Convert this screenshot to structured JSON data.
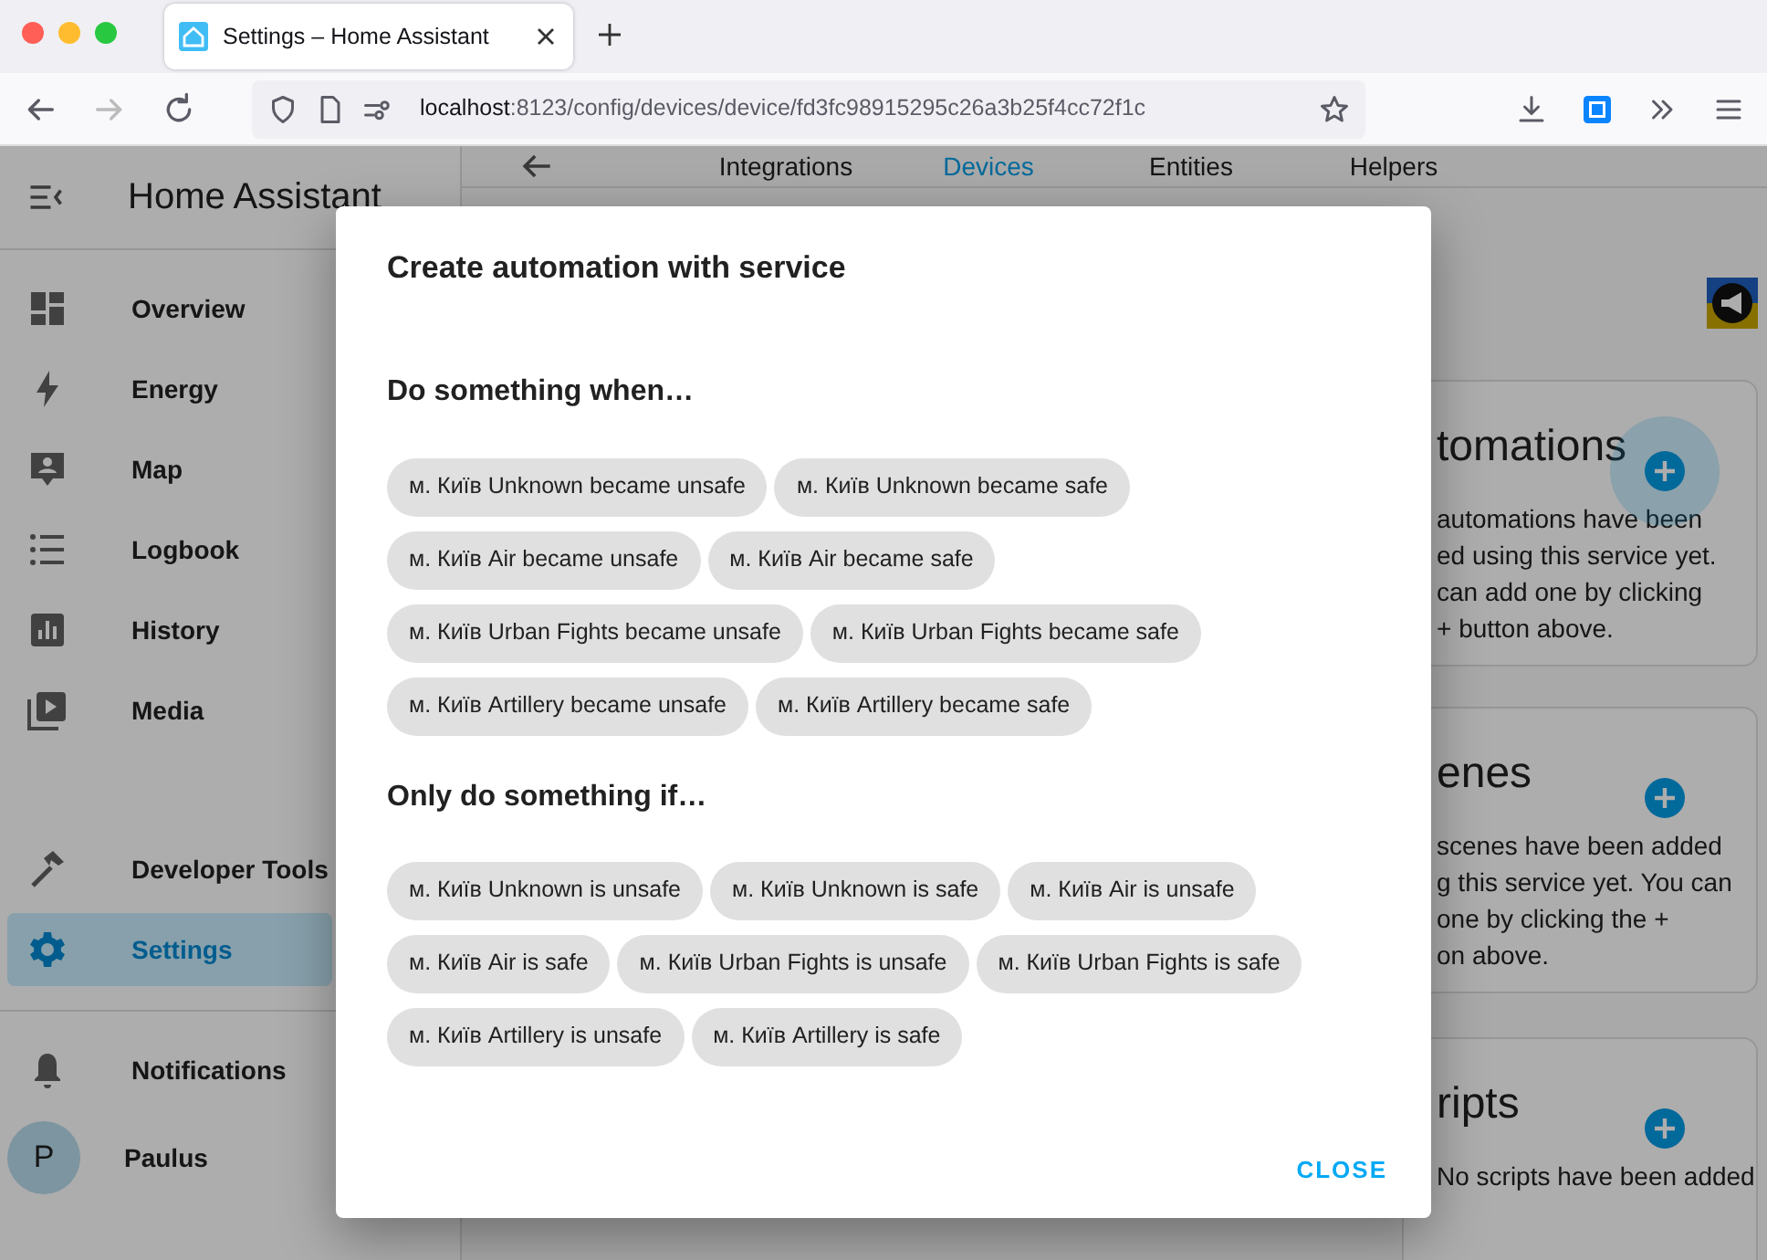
{
  "browser": {
    "tab_title": "Settings – Home Assistant",
    "url_host": "localhost",
    "url_path": ":8123/config/devices/device/fd3fc98915295c26a3b25f4cc72f1c"
  },
  "sidebar": {
    "title": "Home Assistant",
    "items": [
      {
        "label": "Overview",
        "selected": false
      },
      {
        "label": "Energy",
        "selected": false
      },
      {
        "label": "Map",
        "selected": false
      },
      {
        "label": "Logbook",
        "selected": false
      },
      {
        "label": "History",
        "selected": false
      },
      {
        "label": "Media",
        "selected": false
      }
    ],
    "tool_items": [
      {
        "label": "Developer Tools",
        "selected": false
      },
      {
        "label": "Settings",
        "selected": true
      }
    ],
    "notifications": "Notifications",
    "user": {
      "initial": "P",
      "name": "Paulus"
    }
  },
  "tabs": [
    {
      "label": "Integrations",
      "selected": false
    },
    {
      "label": "Devices",
      "selected": true
    },
    {
      "label": "Entities",
      "selected": false
    },
    {
      "label": "Helpers",
      "selected": false
    }
  ],
  "cards": [
    {
      "title": "tomations",
      "hovered": true,
      "lines": [
        "automations have been",
        "ed using this service yet.",
        "can add one by clicking",
        "+ button above."
      ]
    },
    {
      "title": "enes",
      "hovered": false,
      "lines": [
        "scenes have been added",
        "g this service yet. You can",
        "one by clicking the +",
        "on above."
      ]
    },
    {
      "title": "ripts",
      "hovered": false,
      "lines": [
        "No scripts have been added"
      ]
    }
  ],
  "dialog": {
    "title": "Create automation with service",
    "sections": [
      {
        "heading": "Do something when…",
        "chips": [
          "м. Київ Unknown became unsafe",
          "м. Київ Unknown became safe",
          "м. Київ Air became unsafe",
          "м. Київ Air became safe",
          "м. Київ Urban Fights became unsafe",
          "м. Київ Urban Fights became safe",
          "м. Київ Artillery became unsafe",
          "м. Київ Artillery became safe"
        ]
      },
      {
        "heading": "Only do something if…",
        "chips": [
          "м. Київ Unknown is unsafe",
          "м. Київ Unknown is safe",
          "м. Київ Air is unsafe",
          "м. Київ Air is safe",
          "м. Київ Urban Fights is unsafe",
          "м. Київ Urban Fights is safe",
          "м. Київ Artillery is unsafe",
          "м. Київ Artillery is safe"
        ]
      }
    ],
    "close": "CLOSE"
  }
}
